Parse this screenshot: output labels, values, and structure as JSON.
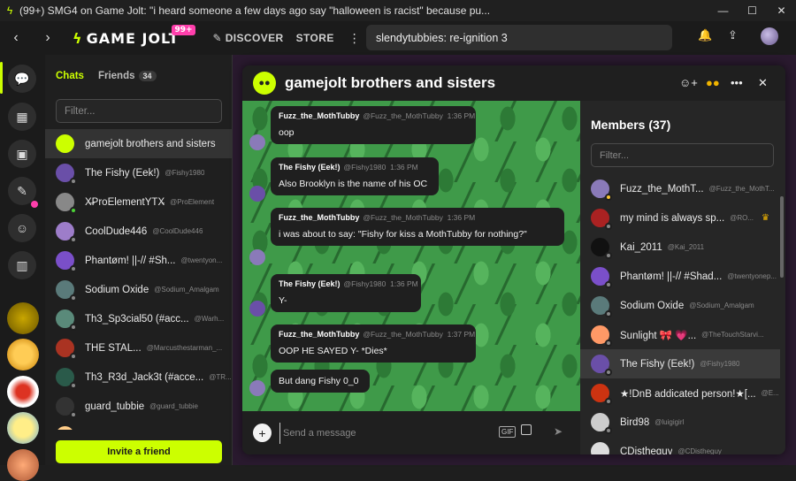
{
  "window": {
    "title": "(99+) SMG4 on Game Jolt: \"i heard someone a few days ago say \"halloween is racist\" because pu...",
    "controls": {
      "minimize": "—",
      "maximize": "☐",
      "close": "✕"
    }
  },
  "topbar": {
    "back": "‹",
    "forward": "›",
    "logo": "GAME JOLT",
    "logo_badge": "99+",
    "discover": "DISCOVER",
    "store": "STORE",
    "more": "⋮",
    "search_value": "slendytubbies: re-ignition 3"
  },
  "chats_panel": {
    "tab_chats": "Chats",
    "tab_friends": "Friends",
    "friends_count": "34",
    "filter_placeholder": "Filter...",
    "invite_button": "Invite a friend",
    "items": [
      {
        "name": "gamejolt brothers and sisters",
        "handle": "",
        "avatar_color": "#ccff00",
        "status": "none",
        "selected": true
      },
      {
        "name": "The Fishy (Eek!)",
        "handle": "@Fishy1980",
        "avatar_color": "#6a4fa8",
        "status": "offline"
      },
      {
        "name": "X̶ProElementYTX̶",
        "handle": "@ProElement",
        "avatar_color": "#888",
        "status": "online"
      },
      {
        "name": "CoolDude446",
        "handle": "@CoolDude446",
        "avatar_color": "#9d7dc9",
        "status": "offline"
      },
      {
        "name": "Phantøm! ||-// #Sh...",
        "handle": "@twentyon...",
        "avatar_color": "#7a4fc9",
        "status": "offline"
      },
      {
        "name": "Sodium Oxide",
        "handle": "@Sodium_Amalgam",
        "avatar_color": "#5a7a7a",
        "status": "offline"
      },
      {
        "name": "Th3_Sp3cial50 (#acc...",
        "handle": "@Warh...",
        "avatar_color": "#5a8a7a",
        "status": "offline"
      },
      {
        "name": "THE STAL...",
        "handle": "@Marcusthestarman_...",
        "avatar_color": "#aa3322",
        "status": "offline"
      },
      {
        "name": "Th3_R3d_Jack3t (#acce...",
        "handle": "@TR...",
        "avatar_color": "#2a5a4a",
        "status": "offline"
      },
      {
        "name": "guard_tubbie",
        "handle": "@guard_tubbie",
        "avatar_color": "#333",
        "status": "offline"
      },
      {
        "name": "Deathbeargam",
        "handle": "@Deathbeargra...",
        "avatar_color": "#ffcc88",
        "status": "offline"
      }
    ]
  },
  "chat": {
    "title": "gamejolt brothers and sisters",
    "messages": [
      {
        "author": "Fuzz_the_MothTubby",
        "handle": "@Fuzz_the_MothTubby",
        "time": "1:36 PM",
        "text": "oop"
      },
      {
        "author": "The Fishy (Eek!)",
        "handle": "@Fishy1980",
        "time": "1:36 PM",
        "text": "Also Brooklyn is the name of his OC"
      },
      {
        "author": "Fuzz_the_MothTubby",
        "handle": "@Fuzz_the_MothTubby",
        "time": "1:36 PM",
        "text": "i was about to say: \"Fishy for kiss a MothTubby for nothing?\""
      },
      {
        "author": "The Fishy (Eek!)",
        "handle": "@Fishy1980",
        "time": "1:36 PM",
        "text": "Y-"
      },
      {
        "author": "Fuzz_the_MothTubby",
        "handle": "@Fuzz_the_MothTubby",
        "time": "1:37 PM",
        "text": "OOP HE SAYED Y- *Dies*"
      },
      {
        "author": "",
        "handle": "",
        "time": "",
        "text": "But dang Fishy 0_0"
      }
    ],
    "composer_placeholder": "Send a message",
    "gif_label": "GIF"
  },
  "members": {
    "title": "Members (37)",
    "filter_placeholder": "Filter...",
    "items": [
      {
        "name": "Fuzz_the_MothT...",
        "handle": "@Fuzz_the_MothT...",
        "avatar_color": "#8a7ab9",
        "status": "away"
      },
      {
        "name": "my mind is always sp...",
        "handle": "@RO...",
        "avatar_color": "#aa2222",
        "status": "offline",
        "crown": true
      },
      {
        "name": "Kai_2011",
        "handle": "@Kai_2011",
        "avatar_color": "#111",
        "status": "offline"
      },
      {
        "name": "Phantøm! ||-// #Shad...",
        "handle": "@twentyonep...",
        "avatar_color": "#7a4fc9",
        "status": "offline"
      },
      {
        "name": "Sodium Oxide",
        "handle": "@Sodium_Amalgam",
        "avatar_color": "#5a7a7a",
        "status": "offline"
      },
      {
        "name": "Sunlight 🎀 💗...",
        "handle": "@TheTouchStarvi...",
        "avatar_color": "#ff9966",
        "status": "offline"
      },
      {
        "name": "The Fishy (Eek!)",
        "handle": "@Fishy1980",
        "avatar_color": "#6a4fa8",
        "status": "offline",
        "selected": true
      },
      {
        "name": "★!DnB addicated person!★[...",
        "handle": "@E...",
        "avatar_color": "#cc3311",
        "status": "offline"
      },
      {
        "name": "Bird98",
        "handle": "@luigigirl",
        "avatar_color": "#ccc",
        "status": "offline"
      },
      {
        "name": "CDistheguy",
        "handle": "@CDistheguy",
        "avatar_color": "#ddd",
        "status": "offline"
      }
    ]
  },
  "colors": {
    "accent": "#ccff00",
    "badge": "#ff3fac",
    "online": "#4cd137",
    "away": "#fbc531",
    "offline": "#888"
  }
}
